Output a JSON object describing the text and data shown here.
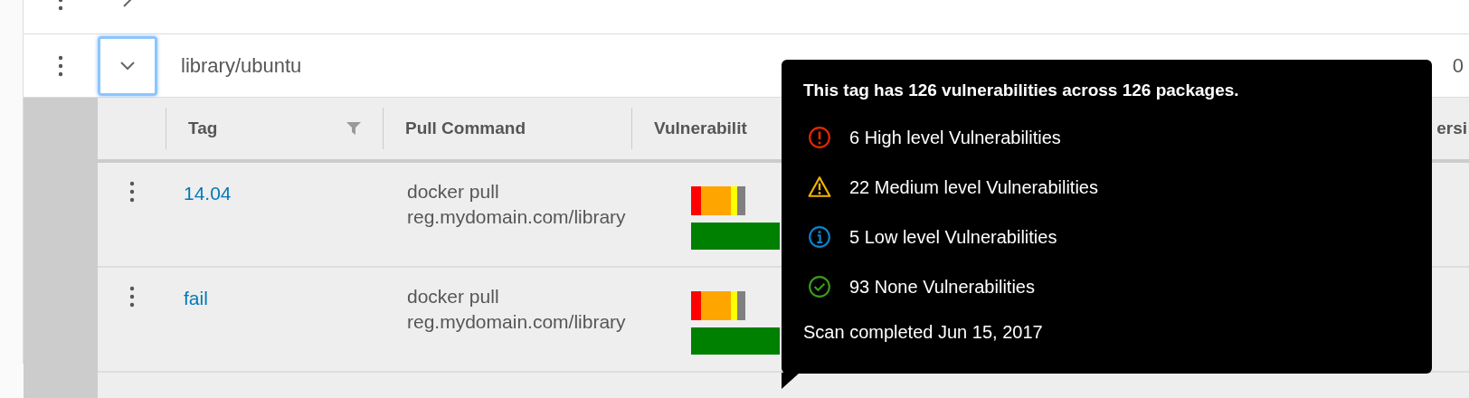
{
  "repositories": [
    {
      "expanded": false,
      "focused": false
    },
    {
      "name": "library/ubuntu",
      "expanded": true,
      "focused": true,
      "column_3": "0"
    }
  ],
  "tags_table": {
    "columns": [
      {
        "label": "Tag",
        "filter": true
      },
      {
        "label": "Pull Command",
        "filter": false
      },
      {
        "label": "Vulnerabilit",
        "filter": false
      }
    ],
    "column_right": "ersi",
    "rows": [
      {
        "tag": "14.04",
        "pull_command": [
          "docker pull",
          "reg.mydomain.com/library"
        ]
      },
      {
        "tag": "fail",
        "pull_command": [
          "docker pull",
          "reg.mydomain.com/library"
        ]
      }
    ]
  },
  "tooltip": {
    "title": "This tag has 126 vulnerabilities across 126 packages.",
    "items": [
      {
        "kind": "high",
        "text": "6 High level Vulnerabilities"
      },
      {
        "kind": "medium",
        "text": "22 Medium level Vulnerabilities"
      },
      {
        "kind": "low",
        "text": "5 Low level Vulnerabilities"
      },
      {
        "kind": "none",
        "text": "93 None Vulnerabilities"
      }
    ],
    "footer": "Scan completed Jun 15, 2017"
  }
}
